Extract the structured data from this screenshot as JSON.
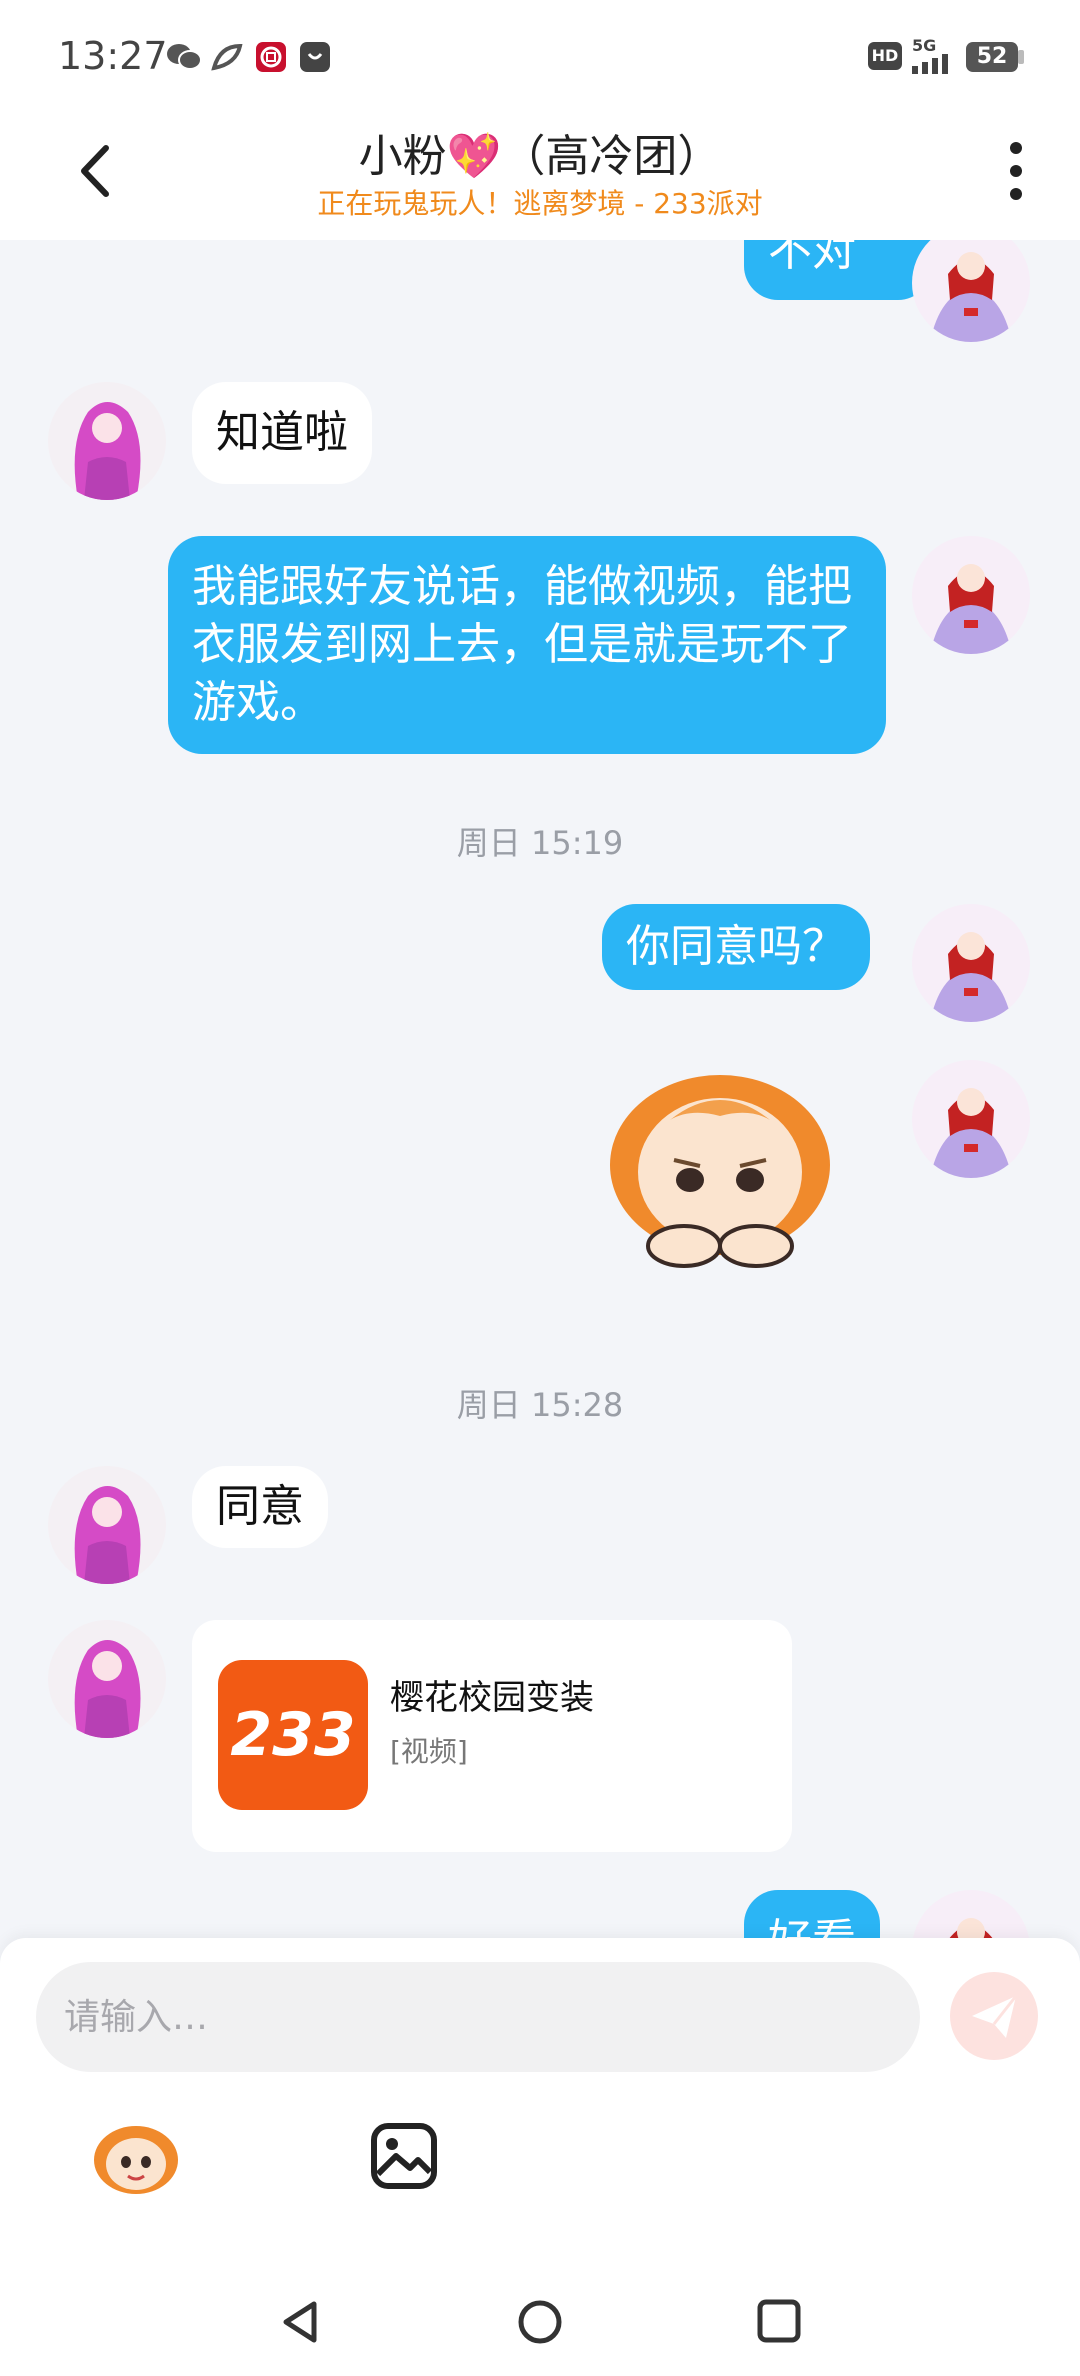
{
  "status": {
    "time": "13:27",
    "battery": "52",
    "hd": "HD",
    "network": "5G"
  },
  "header": {
    "title": "小粉💖（高冷团）",
    "subtitle": "正在玩鬼玩人！逃离梦境 - 233派对"
  },
  "messages": {
    "m1": "不对",
    "m2": "知道啦",
    "m3": "我能跟好友说话，能做视频，能把衣服发到网上去，但是就是玩不了游戏。",
    "t1": "周日 15:19",
    "m4": "你同意吗？",
    "t2": "周日 15:28",
    "m5": "同意",
    "card_title": "樱花校园变装",
    "card_tag": "[视频]",
    "card_logo": "233",
    "m6": "好看"
  },
  "input": {
    "placeholder": "请输入…"
  },
  "icons": {
    "back": "back-arrow-icon",
    "more": "more-vertical-icon",
    "send": "send-plane-icon",
    "emoji": "emoji-mascot-icon",
    "image": "image-picker-icon"
  },
  "colors": {
    "bubble_me": "#2bb5f5",
    "subtitle": "#f08a1c",
    "card_logo": "#f25a14"
  }
}
